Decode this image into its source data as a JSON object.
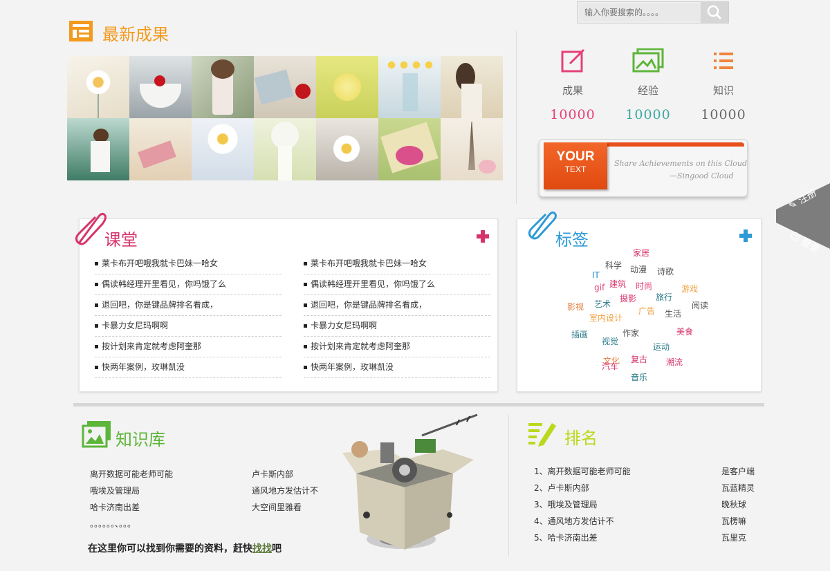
{
  "search": {
    "placeholder": "输入你要搜索的。。。。"
  },
  "latest": {
    "title": "最新成果",
    "photo_count": 14
  },
  "stats": [
    {
      "label": "成果",
      "value": "10000",
      "color": "#e5407a",
      "icon": "edit-icon"
    },
    {
      "label": "经验",
      "value": "10000",
      "color": "#3aa9a0",
      "icon": "image-icon"
    },
    {
      "label": "知识",
      "value": "10000",
      "color": "#666666",
      "icon": "list-icon"
    }
  ],
  "banner": {
    "your": "YOUR",
    "text": "TEXT",
    "line1": "Share Achievements on this Cloud",
    "line2": "—Singood Cloud"
  },
  "classroom": {
    "title": "课堂",
    "col1": [
      "莱卡布开吧哦我就卡巴妹一哈女",
      "偶读韩经理开里看见，你吗饿了么",
      "退回吧，你是键品牌排名看成，",
      "卡暴力女尼玛啊啊",
      "按计划来肯定就考虑阿奎那",
      "快两年案例，玫琳凯没"
    ],
    "col2": [
      "莱卡布开吧哦我就卡巴妹一哈女",
      "偶读韩经理开里看见，你吗饿了么",
      "退回吧，你是键品牌排名看成，",
      "卡暴力女尼玛啊啊",
      "按计划来肯定就考虑阿奎那",
      "快两年案例，玫琳凯没"
    ]
  },
  "tags": {
    "title": "标签",
    "items": [
      {
        "t": "家居",
        "c": "#d6336c"
      },
      {
        "t": "科学",
        "c": "#555555"
      },
      {
        "t": "动漫",
        "c": "#555555"
      },
      {
        "t": "诗歌",
        "c": "#555555"
      },
      {
        "t": "IT",
        "c": "#1e88c8"
      },
      {
        "t": "gif",
        "c": "#e5407a"
      },
      {
        "t": "建筑",
        "c": "#d6336c"
      },
      {
        "t": "时尚",
        "c": "#e5407a"
      },
      {
        "t": "游戏",
        "c": "#f0a040"
      },
      {
        "t": "旅行",
        "c": "#2a7a8a"
      },
      {
        "t": "影视",
        "c": "#e88040"
      },
      {
        "t": "艺术",
        "c": "#2a7a8a"
      },
      {
        "t": "摄影",
        "c": "#d6336c"
      },
      {
        "t": "广告",
        "c": "#f0a040"
      },
      {
        "t": "阅读",
        "c": "#555555"
      },
      {
        "t": "生活",
        "c": "#555555"
      },
      {
        "t": "室内设计",
        "c": "#f0a040"
      },
      {
        "t": "插画",
        "c": "#2a7a8a"
      },
      {
        "t": "作家",
        "c": "#555555"
      },
      {
        "t": "美食",
        "c": "#d6336c"
      },
      {
        "t": "视觉",
        "c": "#2a7a8a"
      },
      {
        "t": "运动",
        "c": "#2a7a8a"
      },
      {
        "t": "复古",
        "c": "#d6336c"
      },
      {
        "t": "文化",
        "c": "#e88040"
      },
      {
        "t": "汽车",
        "c": "#d6336c"
      },
      {
        "t": "潮流",
        "c": "#d6336c"
      },
      {
        "t": "音乐",
        "c": "#2a7a8a"
      }
    ]
  },
  "knowledge": {
    "title": "知识库",
    "col1": [
      "离开数据可能老师可能",
      "哦埃及管理局",
      "哈卡济南出差",
      "。。。。。。、。。。"
    ],
    "col2": [
      "卢卡斯内部",
      "通风地方发估计不",
      "大空间里雅看"
    ],
    "cta_pre": "在这里你可以找到你需要的资料，赶快",
    "cta_link": "找找",
    "cta_post": "吧"
  },
  "ranking": {
    "title": "排名",
    "items": [
      {
        "n": "1、离开数据可能老师可能",
        "r": "是客户端"
      },
      {
        "n": "2、卢卡斯内部",
        "r": "瓦蓝精灵"
      },
      {
        "n": "3、哦埃及管理局",
        "r": "晚秋球"
      },
      {
        "n": "4、通风地方发估计不",
        "r": "瓦楞嘛"
      },
      {
        "n": "5、哈卡济南出差",
        "r": "瓦里克"
      }
    ]
  },
  "side": {
    "register": "注册",
    "login": "登录"
  },
  "colors": {
    "orange": "#f39a1e",
    "pink": "#d6336c",
    "blue": "#2d9ad6",
    "green": "#5db53a",
    "lime": "#b9d91c"
  }
}
